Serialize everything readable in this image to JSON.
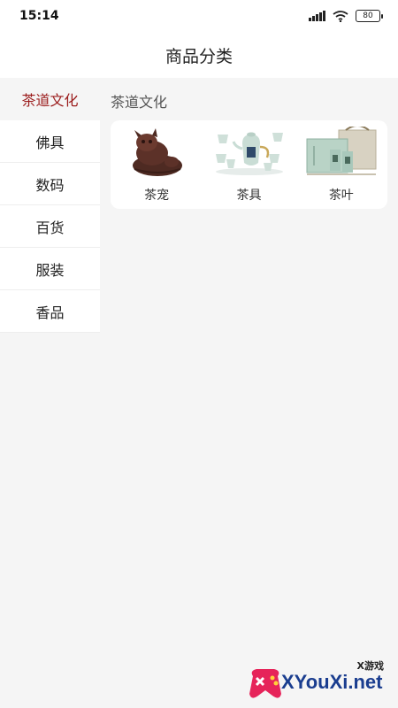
{
  "status_bar": {
    "time": "15:14",
    "battery": "80"
  },
  "header": {
    "title": "商品分类"
  },
  "sidebar": {
    "items": [
      {
        "label": "茶道文化",
        "active": true
      },
      {
        "label": "佛具"
      },
      {
        "label": "数码"
      },
      {
        "label": "百货"
      },
      {
        "label": "服装"
      },
      {
        "label": "香品"
      }
    ]
  },
  "content": {
    "section_title": "茶道文化",
    "items": [
      {
        "label": "茶宠",
        "icon": "tea-pet-image"
      },
      {
        "label": "茶具",
        "icon": "tea-set-image"
      },
      {
        "label": "茶叶",
        "icon": "tea-leaves-box-image"
      }
    ]
  },
  "watermark": {
    "small_text": "X游戏",
    "big_text": "XYouXi.net"
  },
  "colors": {
    "accent": "#9b1c1c",
    "background": "#f5f5f5"
  }
}
